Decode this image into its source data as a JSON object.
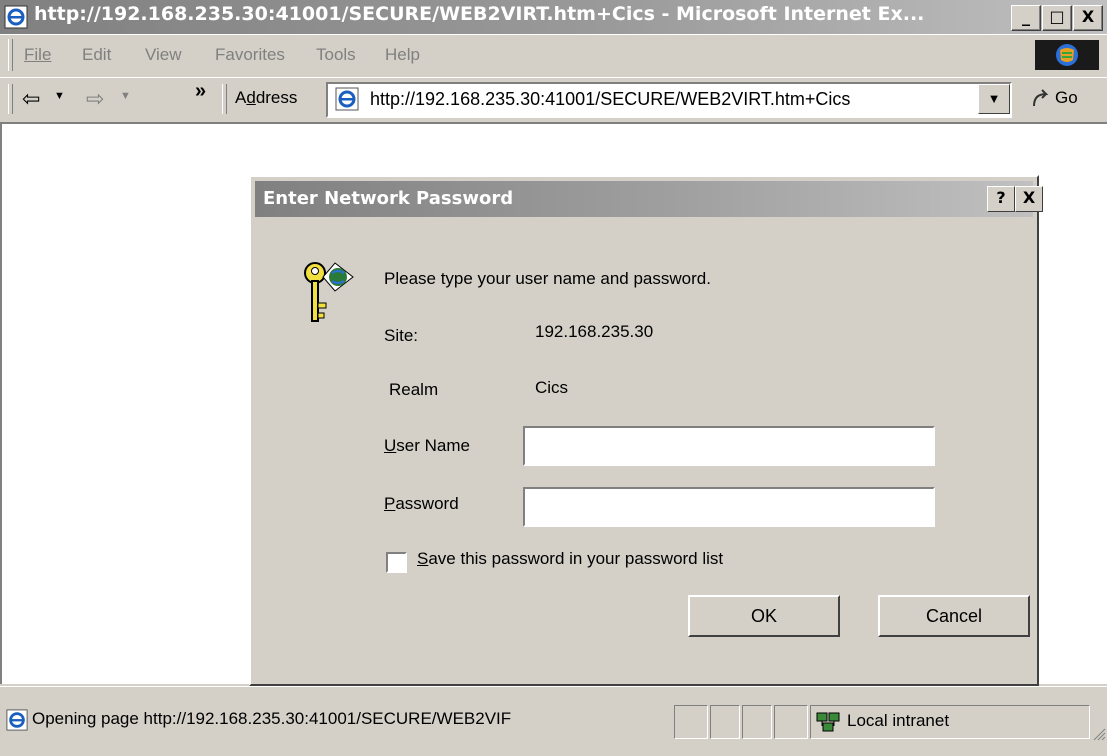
{
  "window": {
    "title": "http://192.168.235.30:41001/SECURE/WEB2VIRT.htm+Cics - Microsoft Internet Ex...",
    "minimize": "_",
    "maximize": "□",
    "close": "X"
  },
  "menu": {
    "file": "File",
    "edit": "Edit",
    "view": "View",
    "favorites": "Favorites",
    "tools": "Tools",
    "help": "Help"
  },
  "toolbar": {
    "back": "⇦",
    "forward": "⇨",
    "more": "»",
    "address_label": "Address",
    "address_value": "http://192.168.235.30:41001/SECURE/WEB2VIRT.htm+Cics",
    "go": "Go"
  },
  "dialog": {
    "title": "Enter Network Password",
    "help": "?",
    "close": "X",
    "prompt": "Please type your user name and password.",
    "site_label": "Site:",
    "site_value": "192.168.235.30",
    "realm_label": "Realm",
    "realm_value": "Cics",
    "username_label": "User Name",
    "password_label": "Password",
    "username_value": "",
    "password_value": "",
    "save_password_label": "Save this password in your password list",
    "save_password_checked": false,
    "ok": "OK",
    "cancel": "Cancel"
  },
  "status": {
    "text": "Opening page http://192.168.235.30:41001/SECURE/WEB2VIF",
    "zone": "Local intranet"
  },
  "colors": {
    "face": "#d4d0c8",
    "inactive_title": "#808080"
  },
  "icons": [
    "ie-page-icon",
    "key-icon",
    "globe-icon",
    "intranet-icon",
    "go-arrow-icon"
  ]
}
